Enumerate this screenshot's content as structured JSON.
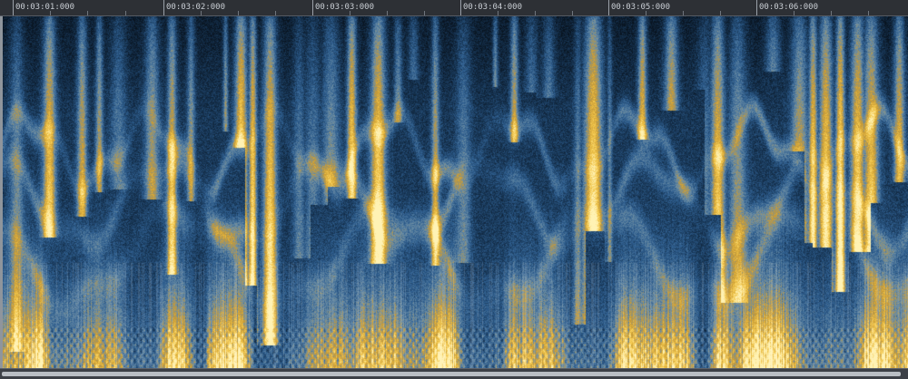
{
  "timeline": {
    "labels": [
      "00:03:01:000",
      "00:03:02:000",
      "00:03:03:000",
      "00:03:04:000",
      "00:03:05:000",
      "00:03:06:000"
    ]
  },
  "spectrogram": {
    "colormap": [
      "#08131f",
      "#163453",
      "#2f5f90",
      "#6b8da4",
      "#c79a35",
      "#f2c64a",
      "#fff2b4"
    ]
  },
  "colors": {
    "background": "#23262b",
    "ruler": "#2d3035",
    "scrollbar": "#3c4047"
  }
}
